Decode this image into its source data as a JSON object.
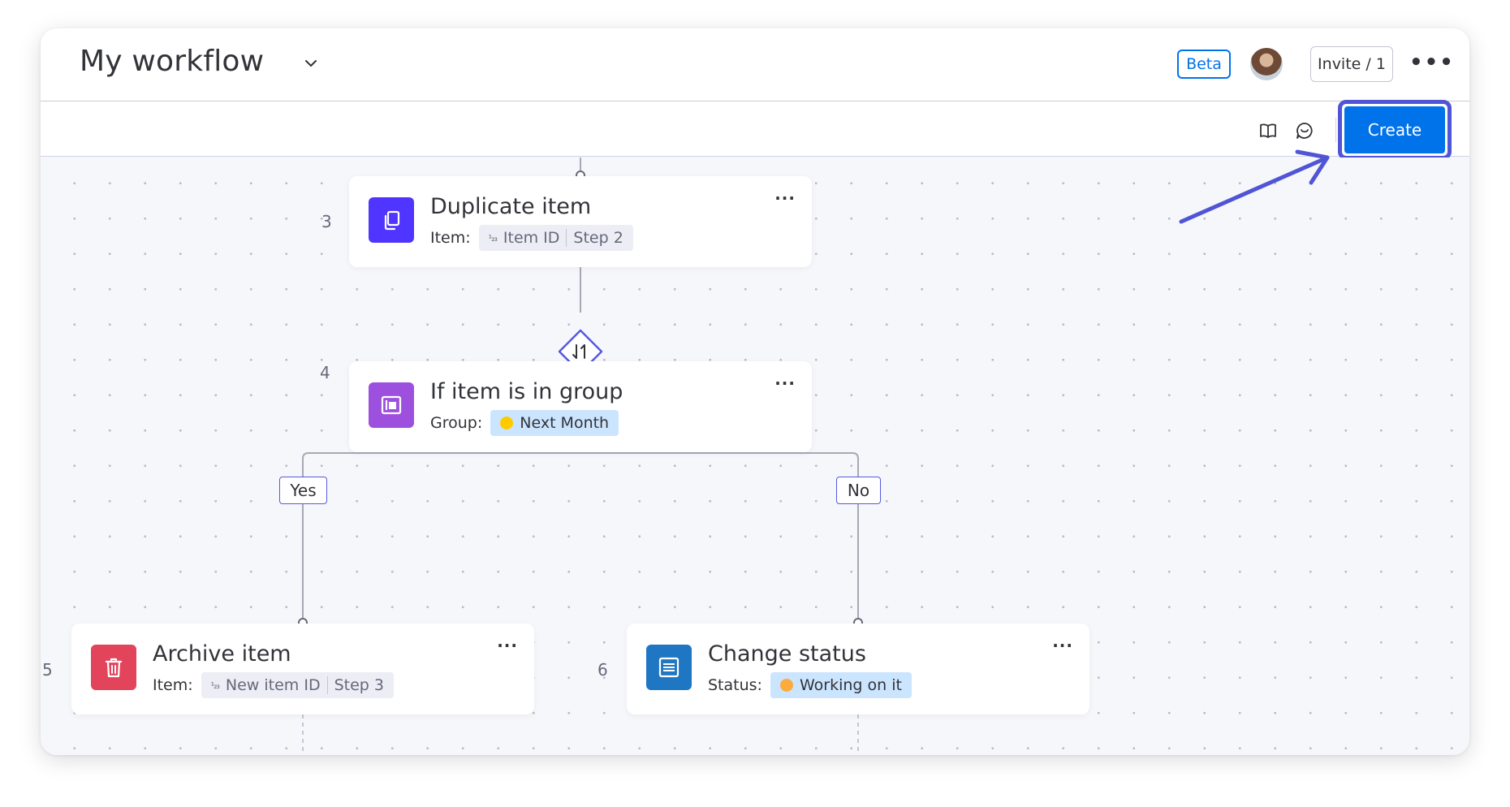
{
  "header": {
    "title": "My workflow",
    "beta_label": "Beta",
    "invite_label": "Invite / 1",
    "more_label": "•••"
  },
  "toolbar": {
    "create_label": "Create"
  },
  "steps": [
    {
      "number": "3",
      "title": "Duplicate item",
      "field_label": "Item:",
      "chip_icon": "¹₂₃",
      "chip_text": "Item ID",
      "chip_step": "Step 2",
      "icon": "copy-icon",
      "icon_color": "#5034ff"
    },
    {
      "number": "4",
      "title": "If item is in group",
      "field_label": "Group:",
      "chip_text": "Next Month",
      "dot_color": "#ffcb00",
      "icon": "group-icon",
      "icon_color": "#9d50dd"
    },
    {
      "number": "5",
      "title": "Archive item",
      "field_label": "Item:",
      "chip_icon": "¹₂₃",
      "chip_text": "New item ID",
      "chip_step": "Step 3",
      "icon": "trash-icon",
      "icon_color": "#e2445c"
    },
    {
      "number": "6",
      "title": "Change status",
      "field_label": "Status:",
      "chip_text": "Working on it",
      "dot_color": "#fdab3d",
      "icon": "status-column-icon",
      "icon_color": "#1f76c2"
    }
  ],
  "branches": {
    "yes_label": "Yes",
    "no_label": "No"
  },
  "card_more_label": "···",
  "colors": {
    "primary": "#0073ea",
    "highlight": "#5055d5",
    "canvas": "#f6f7fb"
  }
}
